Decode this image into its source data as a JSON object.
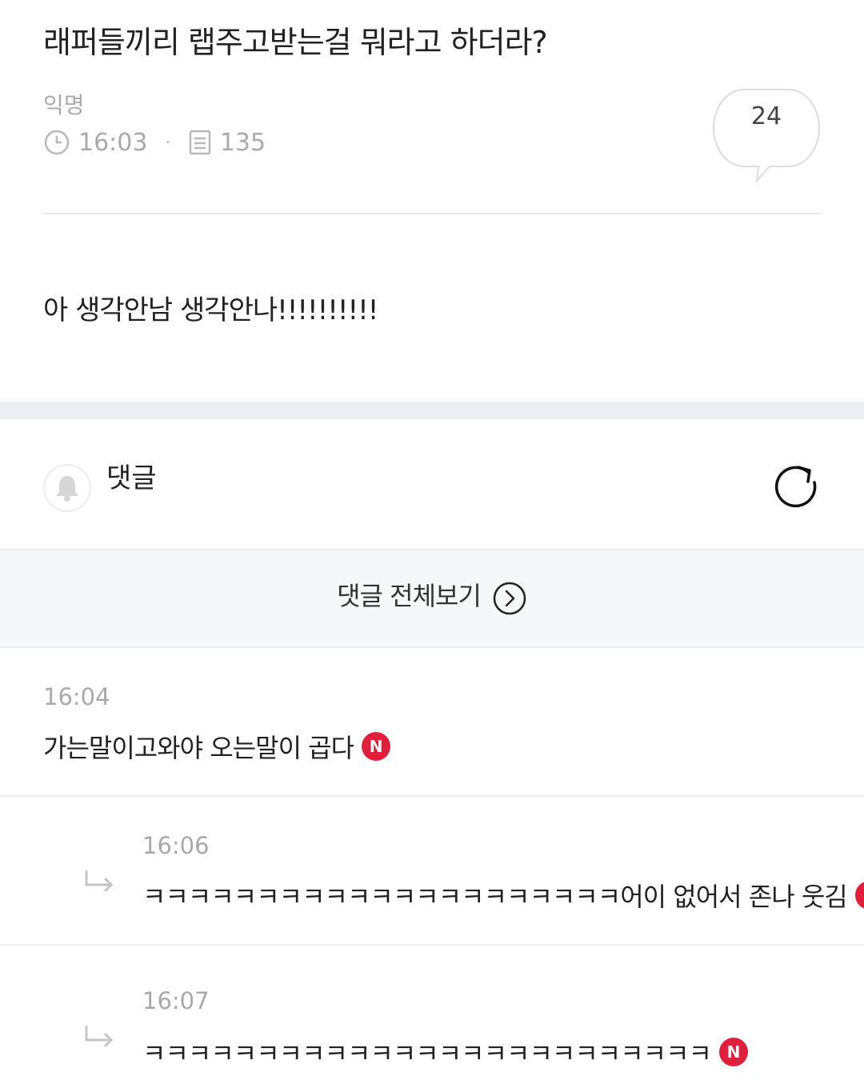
{
  "post": {
    "title": "래퍼들끼리 랩주고받는걸 뭐라고 하더라?",
    "author": "익명",
    "time": "16:03",
    "views": "135",
    "comment_count": "24",
    "body": "아 생각안남 생각안나!!!!!!!!!!"
  },
  "comments_section": {
    "label": "댓글",
    "view_all_label": "댓글 전체보기"
  },
  "comments": [
    {
      "time": "16:04",
      "text": "가는말이고와야 오는말이 곱다",
      "badge": "N"
    },
    {
      "time": "16:06",
      "text": "ㅋㅋㅋㅋㅋㅋㅋㅋㅋㅋㅋㅋㅋㅋㅋㅋㅋㅋㅋㅋㅋ어이 없어서 존나 웃김",
      "badge": "N"
    },
    {
      "time": "16:07",
      "text": "ㅋㅋㅋㅋㅋㅋㅋㅋㅋㅋㅋㅋㅋㅋㅋㅋㅋㅋㅋㅋㅋㅋㅋㅋㅋ",
      "badge": "N"
    }
  ],
  "colors": {
    "badge": "#e0203a",
    "meta_gray": "#aaaaaa",
    "band": "#eceef1"
  },
  "icons": {
    "time": "clock-icon",
    "views": "document-icon",
    "comments": "speech-bubble-icon",
    "notify": "bell-icon",
    "refresh": "refresh-icon",
    "view_all": "chevron-right-circle-icon",
    "reply": "reply-arrow-icon"
  }
}
